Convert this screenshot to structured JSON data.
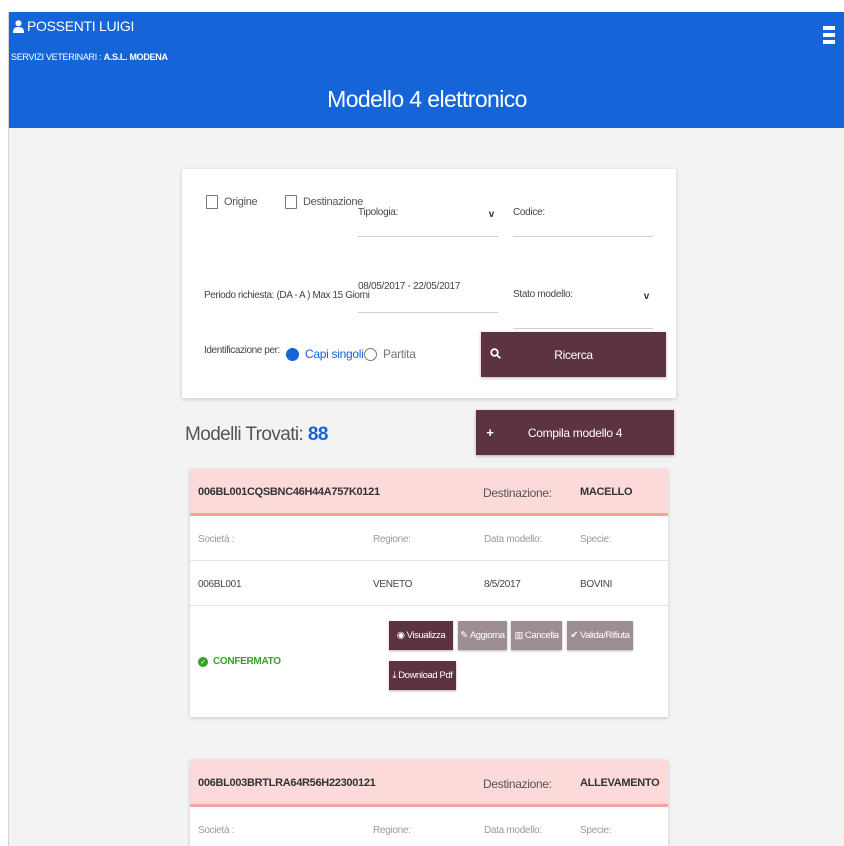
{
  "header": {
    "user_name": "POSSENTI LUIGI",
    "service_prefix": "SERVIZI VETERINARI : ",
    "service_name": "A.S.L. MODENA",
    "title": "Modello 4 elettronico",
    "menu_icon": "hamburger-menu-icon",
    "user_icon": "user-icon",
    "color": "#1565d8"
  },
  "search": {
    "origin_label": "Origine",
    "destination_label": "Destinazione",
    "tipologia_label": "Tipologia:",
    "codice_label": "Codice:",
    "period_label": "Periodo richiesta: (DA - A ) Max 15 Giorni",
    "period_value": "08/05/2017 - 22/05/2017",
    "stato_label": "Stato modello:",
    "identification_label": "Identificazione per:",
    "option_single": "Capi singoli",
    "option_batch": "Partita",
    "search_button": "Ricerca",
    "search_icon": "search-icon"
  },
  "results": {
    "found_label": "Modelli Trovati: ",
    "found_count": "88",
    "compile_button": "Compila modello 4",
    "plus_icon": "plus-icon"
  },
  "cards": [
    {
      "code": "006BL001CQSBNC46H44A757K0121",
      "dest_label": "Destinazione:",
      "dest_value": "MACELLO",
      "col_societa": "Società :",
      "col_regione": "Regione:",
      "col_data": "Data modello:",
      "col_specie": "Specie:",
      "societa": "006BL001",
      "regione": "VENETO",
      "data": "8/5/2017",
      "specie": "BOVINI",
      "status": "CONFERMATO",
      "actions": {
        "view": "Visualizza",
        "update": "Aggiorna",
        "delete": "Cancella",
        "validate": "Valida/Rifiuta",
        "download": "Download Pdf"
      }
    },
    {
      "code": "006BL003BRTLRA64R56H22300121",
      "dest_label": "Destinazione:",
      "dest_value": "ALLEVAMENTO",
      "col_societa": "Società :",
      "col_regione": "Regione:",
      "col_data": "Data modello:",
      "col_specie": "Specie:"
    }
  ],
  "colors": {
    "primary": "#1565d8",
    "button_dark": "#5d333f",
    "card_header": "#fcdada",
    "status_ok": "#3aa02a"
  }
}
